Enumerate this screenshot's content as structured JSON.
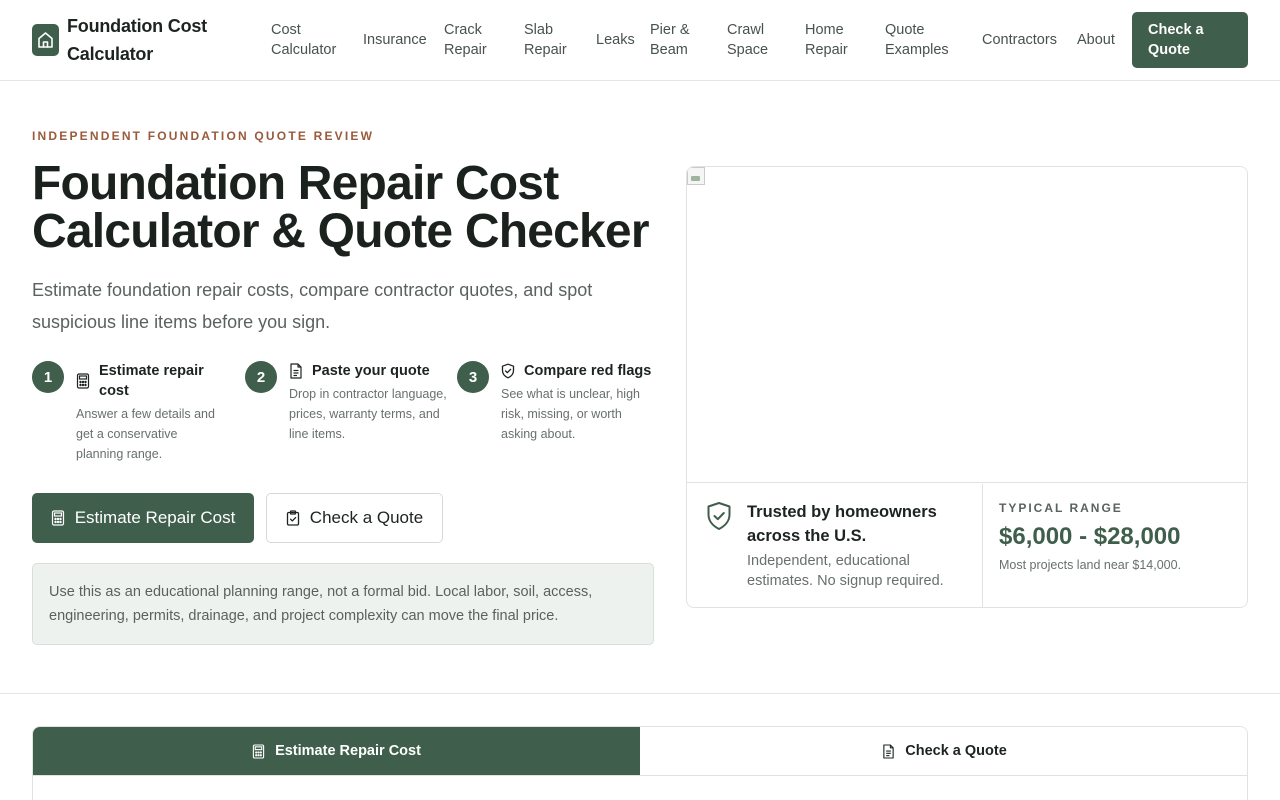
{
  "header": {
    "brand": "Foundation Cost Calculator",
    "nav": [
      {
        "label": "Cost Calculator"
      },
      {
        "label": "Insurance"
      },
      {
        "label": "Crack Repair"
      },
      {
        "label": "Slab Repair"
      },
      {
        "label": "Leaks"
      },
      {
        "label": "Pier & Beam"
      },
      {
        "label": "Crawl Space"
      },
      {
        "label": "Home Repair"
      },
      {
        "label": "Quote Examples"
      },
      {
        "label": "Contractors"
      },
      {
        "label": "About"
      }
    ],
    "cta": "Check a Quote"
  },
  "hero": {
    "eyebrow": "INDEPENDENT FOUNDATION QUOTE REVIEW",
    "title_line1": "Foundation Repair Cost",
    "title_line2": "Calculator & Quote Checker",
    "subtitle": "Estimate foundation repair costs, compare contractor quotes, and spot suspicious line items before you sign.",
    "steps": [
      {
        "number": "1",
        "icon": "calculator-icon",
        "title": "Estimate repair cost",
        "desc": "Answer a few details and get a conservative planning range."
      },
      {
        "number": "2",
        "icon": "document-icon",
        "title": "Paste your quote",
        "desc": "Drop in contractor language, prices, warranty terms, and line items."
      },
      {
        "number": "3",
        "icon": "shield-check-icon",
        "title": "Compare red flags",
        "desc": "See what is unclear, high risk, missing, or worth asking about."
      }
    ],
    "primary_button": "Estimate Repair Cost",
    "secondary_button": "Check a Quote",
    "note": "Use this as an educational planning range, not a formal bid. Local labor, soil, access, engineering, permits, drainage, and project complexity can move the final price."
  },
  "card": {
    "trust_title": "Trusted by homeowners across the U.S.",
    "trust_desc": "Independent, educational estimates. No signup required.",
    "range_label": "TYPICAL RANGE",
    "range_value": "$6,000 - $28,000",
    "range_note": "Most projects land near $14,000."
  },
  "tabs": {
    "active": "Estimate Repair Cost",
    "inactive": "Check a Quote"
  },
  "colors": {
    "accent": "#3f5e4b",
    "eyebrow": "#9a5a3c",
    "note_bg": "#eef2ef"
  }
}
